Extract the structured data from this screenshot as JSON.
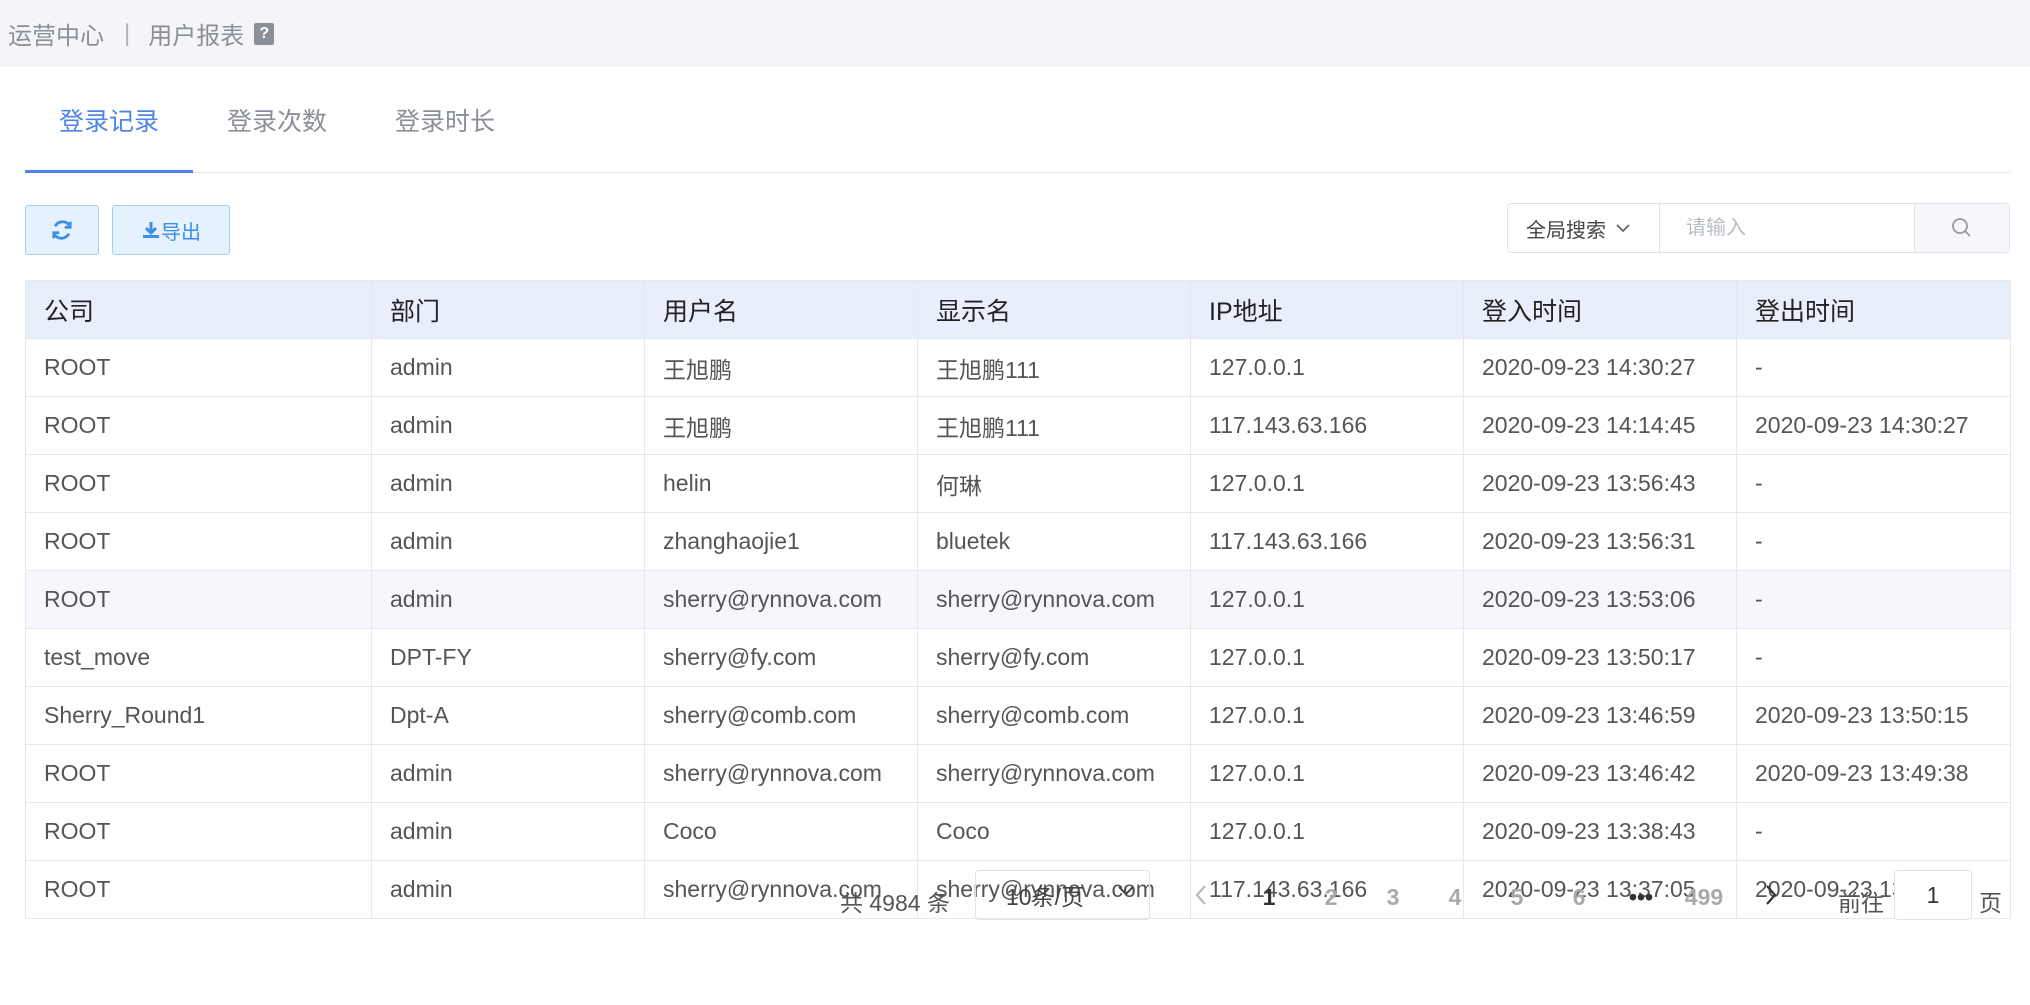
{
  "breadcrumb": {
    "root": "运营中心",
    "separator": "|",
    "current": "用户报表",
    "help": "?"
  },
  "tabs": [
    {
      "label": "登录记录",
      "active": true
    },
    {
      "label": "登录次数",
      "active": false
    },
    {
      "label": "登录时长",
      "active": false
    }
  ],
  "toolbar": {
    "export_label": "导出"
  },
  "search": {
    "scope": "全局搜索",
    "placeholder": "请输入"
  },
  "table": {
    "columns": [
      "公司",
      "部门",
      "用户名",
      "显示名",
      "IP地址",
      "登入时间",
      "登出时间"
    ],
    "rows": [
      [
        "ROOT",
        "admin",
        "王旭鹏",
        "王旭鹏111",
        "127.0.0.1",
        "2020-09-23 14:30:27",
        "-"
      ],
      [
        "ROOT",
        "admin",
        "王旭鹏",
        "王旭鹏111",
        "117.143.63.166",
        "2020-09-23 14:14:45",
        "2020-09-23 14:30:27"
      ],
      [
        "ROOT",
        "admin",
        "helin",
        "何琳",
        "127.0.0.1",
        "2020-09-23 13:56:43",
        "-"
      ],
      [
        "ROOT",
        "admin",
        "zhanghaojie1",
        "bluetek",
        "117.143.63.166",
        "2020-09-23 13:56:31",
        "-"
      ],
      [
        "ROOT",
        "admin",
        "sherry@rynnova.com",
        "sherry@rynnova.com",
        "127.0.0.1",
        "2020-09-23 13:53:06",
        "-"
      ],
      [
        "test_move",
        "DPT-FY",
        "sherry@fy.com",
        "sherry@fy.com",
        "127.0.0.1",
        "2020-09-23 13:50:17",
        "-"
      ],
      [
        "Sherry_Round1",
        "Dpt-A",
        "sherry@comb.com",
        "sherry@comb.com",
        "127.0.0.1",
        "2020-09-23 13:46:59",
        "2020-09-23 13:50:15"
      ],
      [
        "ROOT",
        "admin",
        "sherry@rynnova.com",
        "sherry@rynnova.com",
        "127.0.0.1",
        "2020-09-23 13:46:42",
        "2020-09-23 13:49:38"
      ],
      [
        "ROOT",
        "admin",
        "Coco",
        "Coco",
        "127.0.0.1",
        "2020-09-23 13:38:43",
        "-"
      ],
      [
        "ROOT",
        "admin",
        "sherry@rynnova.com",
        "sherry@rynnova.com",
        "117.143.63.166",
        "2020-09-23 13:37:05",
        "2020-09-23 13:46:42"
      ]
    ]
  },
  "pagination": {
    "total_text": "共 4984 条",
    "page_size": "10条/页",
    "pages": [
      "1",
      "2",
      "3",
      "4",
      "5",
      "6",
      "•••",
      "499"
    ],
    "current_page": "1",
    "goto_prefix": "前往",
    "goto_value": "1",
    "goto_suffix": "页"
  },
  "colors": {
    "accent": "#4f84e8",
    "header_bg": "#e8eefa",
    "button_bg": "#e5f1fc"
  }
}
